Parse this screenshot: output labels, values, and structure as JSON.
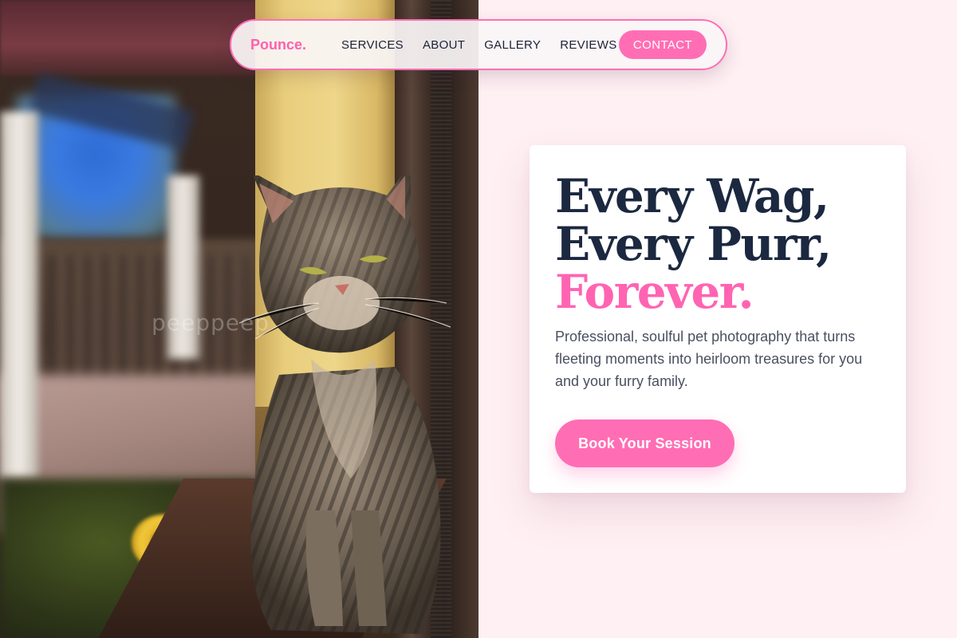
{
  "brand": {
    "logo": "Pounce.",
    "accent_color": "#ff6eb4"
  },
  "nav": {
    "links": [
      "SERVICES",
      "ABOUT",
      "GALLERY",
      "REVIEWS"
    ],
    "contact_label": "CONTACT"
  },
  "hero": {
    "line1": "Every Wag,",
    "line2": "Every Purr,",
    "line3": "Forever.",
    "subtitle": "Professional, soulful pet photography that turns fleeting moments into heirloom treasures for you and your furry family.",
    "cta_label": "Book Your Session"
  },
  "photo": {
    "subject": "tabby-cat-photo",
    "watermark": "peeppeep"
  },
  "colors": {
    "headline": "#1b2840",
    "accent": "#ff64b2",
    "page_bg": "#fff0f4",
    "card_bg": "#ffffff"
  }
}
